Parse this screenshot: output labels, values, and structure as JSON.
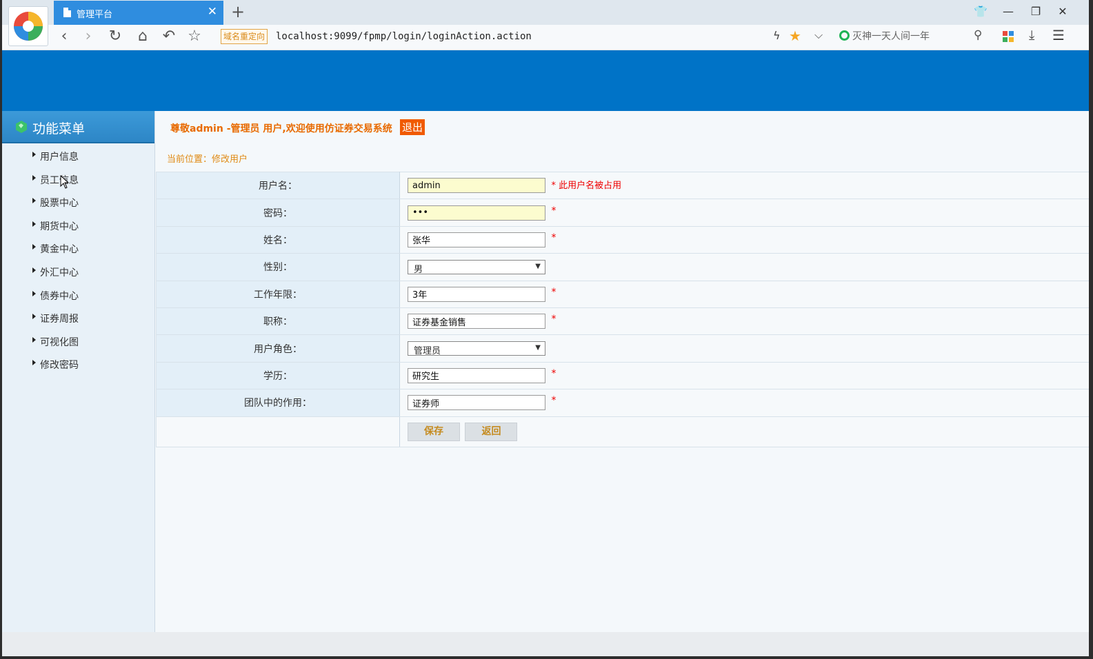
{
  "browser": {
    "tab_title": "管理平台",
    "tab_close": "✕",
    "new_tab": "+",
    "domain_tag": "域名重定向",
    "url": "localhost:9099/fpmp/login/loginAction.action",
    "search_placeholder": "灭神一天人间一年",
    "colors": {
      "tab": "#2f8ddf",
      "banner": "#0073c7"
    }
  },
  "sidebar": {
    "title": "功能菜单",
    "items": [
      {
        "label": "用户信息"
      },
      {
        "label": "员工信息"
      },
      {
        "label": "股票中心"
      },
      {
        "label": "期货中心"
      },
      {
        "label": "黄金中心"
      },
      {
        "label": "外汇中心"
      },
      {
        "label": "债券中心"
      },
      {
        "label": "证券周报"
      },
      {
        "label": "可视化图"
      },
      {
        "label": "修改密码"
      }
    ]
  },
  "header": {
    "welcome": "尊敬admin -管理员 用户,欢迎使用仿证券交易系统",
    "logout": "退出"
  },
  "breadcrumb": "当前位置：修改用户",
  "form": {
    "username": {
      "label": "用户名：",
      "value": "admin",
      "error": "* 此用户名被占用"
    },
    "password": {
      "label": "密码：",
      "value": "•••",
      "required": "*"
    },
    "name": {
      "label": "姓名：",
      "value": "张华",
      "required": "*"
    },
    "gender": {
      "label": "性别：",
      "value": "男",
      "arrow": "▼"
    },
    "work_years": {
      "label": "工作年限：",
      "value": "3年",
      "required": "*"
    },
    "title": {
      "label": "职称：",
      "value": "证券基金销售",
      "required": "*"
    },
    "role": {
      "label": "用户角色：",
      "value": "管理员",
      "arrow": "▼"
    },
    "education": {
      "label": "学历：",
      "value": "研究生",
      "required": "*"
    },
    "team_role": {
      "label": "团队中的作用：",
      "value": "证券师",
      "required": "*"
    },
    "save": "保存",
    "back": "返回"
  }
}
